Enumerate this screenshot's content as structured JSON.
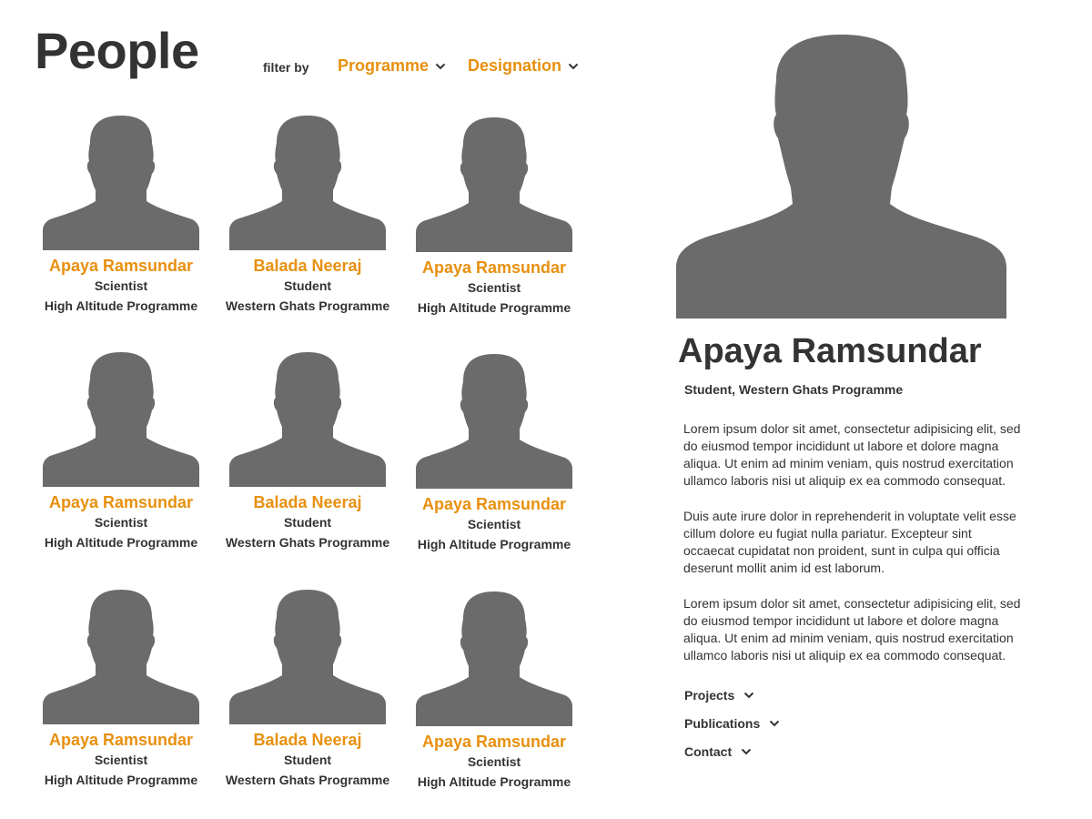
{
  "header": {
    "title": "People",
    "filter_label": "filter by",
    "filters": [
      {
        "label": "Programme",
        "icon": "chevron-down-icon"
      },
      {
        "label": "Designation",
        "icon": "chevron-down-icon"
      }
    ]
  },
  "people": [
    {
      "name": "Apaya Ramsundar",
      "role": "Scientist",
      "programme": "High Altitude Programme"
    },
    {
      "name": "Balada Neeraj",
      "role": "Student",
      "programme": "Western Ghats Programme"
    },
    {
      "name": "Apaya Ramsundar",
      "role": "Scientist",
      "programme": "High Altitude Programme"
    },
    {
      "name": "Apaya Ramsundar",
      "role": "Scientist",
      "programme": "High Altitude Programme"
    },
    {
      "name": "Balada Neeraj",
      "role": "Student",
      "programme": "Western Ghats Programme"
    },
    {
      "name": "Apaya Ramsundar",
      "role": "Scientist",
      "programme": "High Altitude Programme"
    },
    {
      "name": "Apaya Ramsundar",
      "role": "Scientist",
      "programme": "High Altitude Programme"
    },
    {
      "name": "Balada Neeraj",
      "role": "Student",
      "programme": "Western Ghats Programme"
    },
    {
      "name": "Apaya Ramsundar",
      "role": "Scientist",
      "programme": "High Altitude Programme"
    }
  ],
  "detail": {
    "name": "Apaya Ramsundar",
    "subtitle": "Student, Western Ghats Programme",
    "bio": [
      "Lorem ipsum dolor sit amet, consectetur adipisicing elit, sed do eiusmod tempor incididunt ut labore et dolore magna aliqua. Ut enim ad minim veniam, quis nostrud exercitation ullamco laboris nisi ut aliquip ex ea commodo consequat.",
      "Duis aute irure dolor in reprehenderit in voluptate velit esse cillum dolore eu fugiat nulla pariatur. Excepteur sint occaecat cupidatat non proident, sunt in culpa qui officia deserunt mollit anim id est laborum.",
      "Lorem ipsum dolor sit amet, consectetur adipisicing elit, sed do eiusmod tempor incididunt ut labore et dolore magna aliqua. Ut enim ad minim veniam, quis nostrud exercitation ullamco laboris nisi ut aliquip ex ea commodo consequat."
    ],
    "sections": [
      {
        "label": "Projects"
      },
      {
        "label": "Publications"
      },
      {
        "label": "Contact"
      }
    ]
  },
  "colors": {
    "accent": "#e8900f",
    "text": "#333333",
    "silhouette": "#6b6b6b"
  }
}
